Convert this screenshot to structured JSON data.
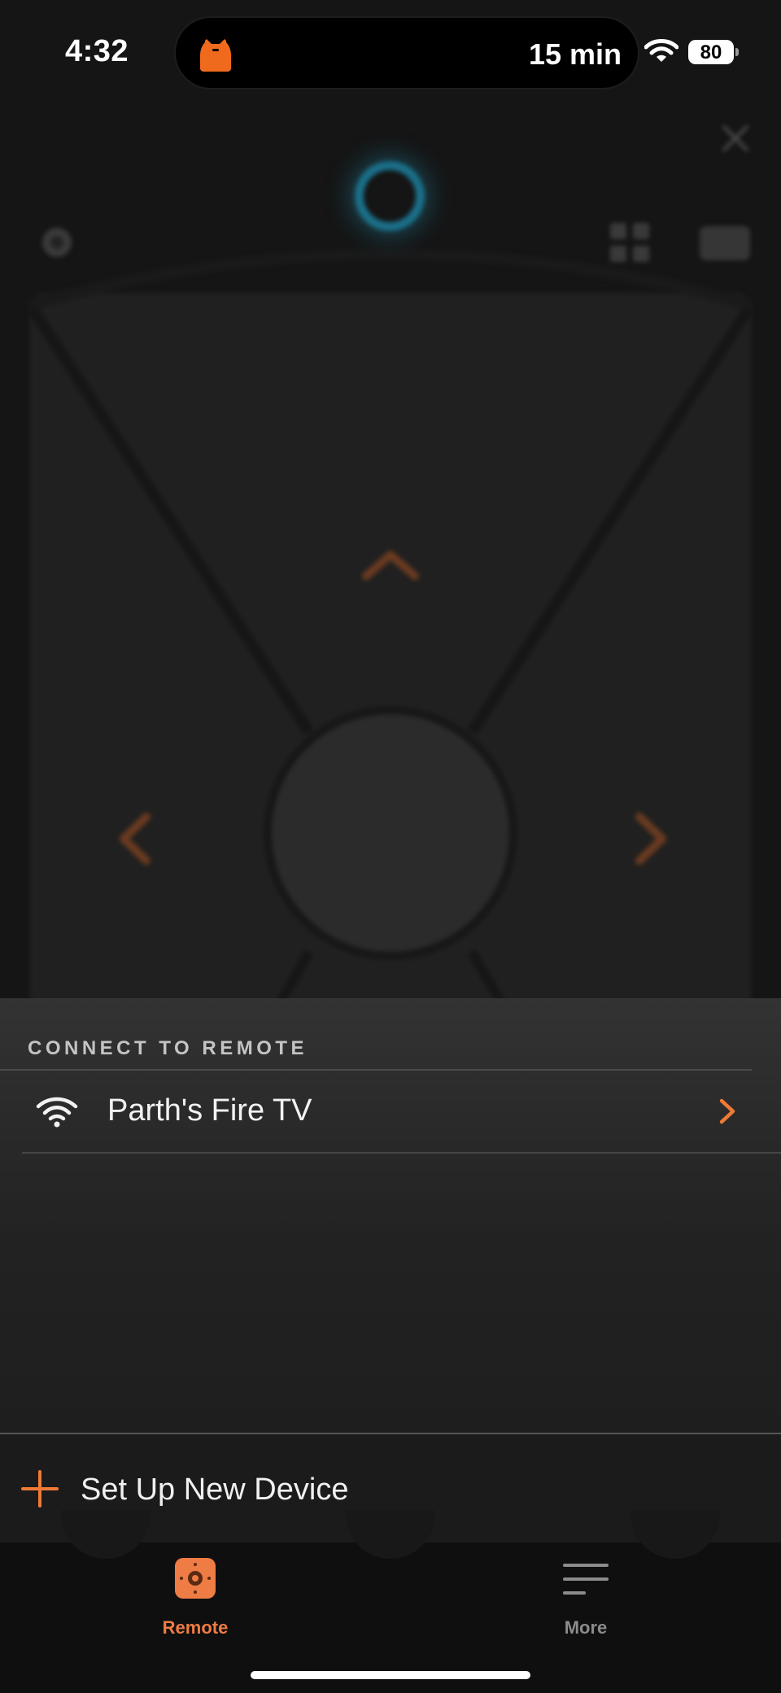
{
  "status_bar": {
    "time": "4:32",
    "island_timer": "15 min",
    "battery_level": "80",
    "island_icon": "orange-app-icon",
    "wifi_icon": "wifi-icon"
  },
  "remote_background": {
    "alexa_icon": "alexa-ring-icon",
    "close_icon": "close-icon",
    "settings_icon": "gear-icon",
    "apps_icon": "apps-grid-icon",
    "keyboard_icon": "keyboard-icon",
    "dpad_icons": [
      "chevron-up-icon",
      "chevron-left-icon",
      "chevron-right-icon"
    ]
  },
  "sheet": {
    "header": "CONNECT TO REMOTE",
    "devices": [
      {
        "name": "Parth's Fire TV",
        "icon": "wifi-icon",
        "chevron": "chevron-right-icon"
      }
    ],
    "setup": {
      "label": "Set Up New Device",
      "icon": "plus-icon"
    }
  },
  "tab_bar": {
    "tabs": [
      {
        "label": "Remote",
        "icon": "remote-icon",
        "active": true
      },
      {
        "label": "More",
        "icon": "menu-lines-icon",
        "active": false
      }
    ]
  },
  "colors": {
    "accent": "#f07a35",
    "background": "#151515",
    "sheet": "#2a2a2a",
    "alexa_blue": "#1b6f89"
  }
}
